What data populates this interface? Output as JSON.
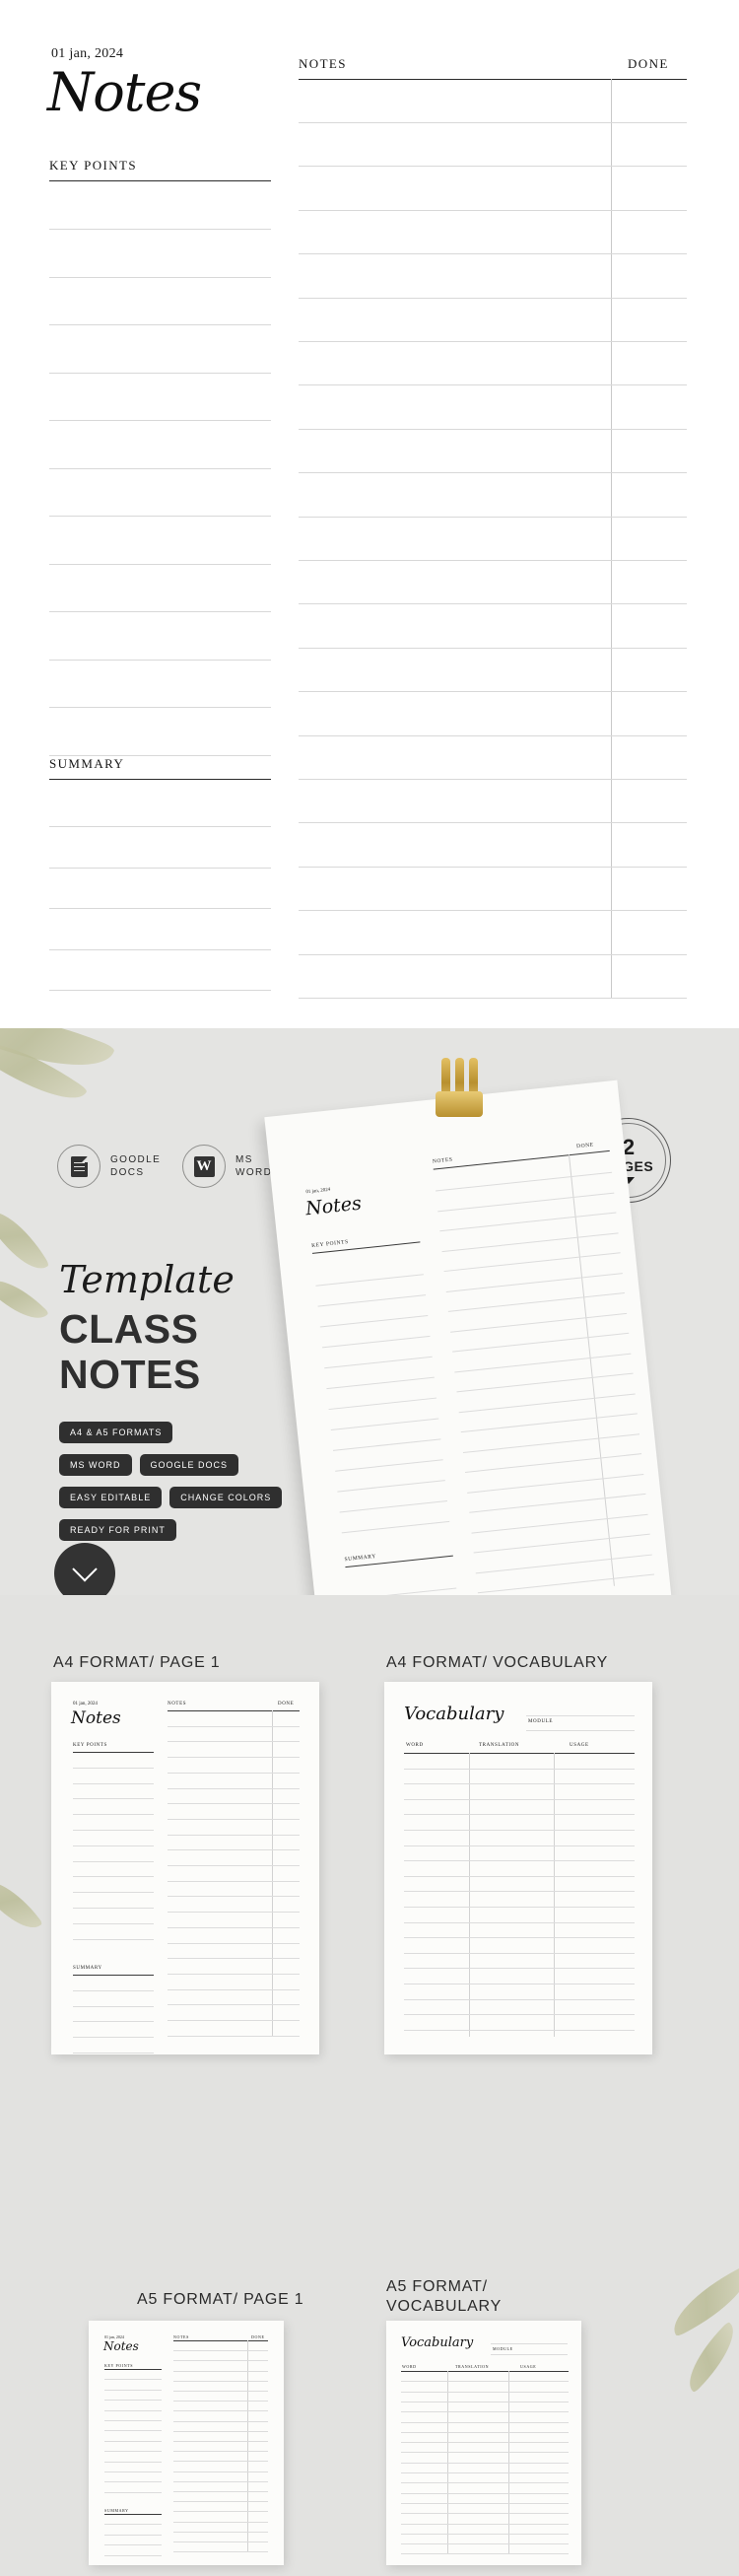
{
  "sheet": {
    "date": "01 jan, 2024",
    "title": "Notes",
    "key_points_label": "KEY POINTS",
    "summary_label": "SUMMARY",
    "notes_col_header": "NOTES",
    "done_col_header": "DONE",
    "key_points_line_count": 12,
    "summary_line_count": 5,
    "notes_line_count": 21
  },
  "promo": {
    "format_badges": [
      {
        "icon": "google-docs-icon",
        "label": "GOODLE\nDOCS"
      },
      {
        "icon": "ms-word-icon",
        "label": "MS\nWORD",
        "glyph": "W"
      }
    ],
    "script_word": "Template",
    "headline_line1": "CLASS",
    "headline_line2": "NOTES",
    "tags": [
      [
        "A4 & A5 FORMATS"
      ],
      [
        "MS WORD",
        "GOOGLE DOCS"
      ],
      [
        "EASY EDITABLE",
        "CHANGE COLORS"
      ],
      [
        "READY FOR PRINT"
      ]
    ],
    "pages_badge": {
      "number": "2",
      "word": "PAGES"
    },
    "scroll_icon": "chevron-down-icon"
  },
  "previews": [
    {
      "label": "A4 FORMAT/ PAGE 1",
      "kind": "notes"
    },
    {
      "label": "A4 FORMAT/ VOCABULARY",
      "kind": "vocabulary"
    },
    {
      "label": "A5 FORMAT/ PAGE 1",
      "kind": "notes"
    },
    {
      "label": "A5 FORMAT/\nVOCABULARY",
      "kind": "vocabulary"
    }
  ],
  "vocabulary": {
    "title": "Vocabulary",
    "module_label": "MODULE",
    "columns": [
      "WORD",
      "TRANSLATION",
      "USAGE"
    ]
  },
  "colors": {
    "page_bg": "#ffffff",
    "promo_bg": "#e4e4e2",
    "preview_bg": "#e2e2e0",
    "paper": "#fcfcfa",
    "ink": "#1b1b1b",
    "dark_chip": "#2f2f2f",
    "rule_light": "#d8d8d8",
    "rule_strong": "#2a2a2a",
    "gold": "#b8902f"
  }
}
